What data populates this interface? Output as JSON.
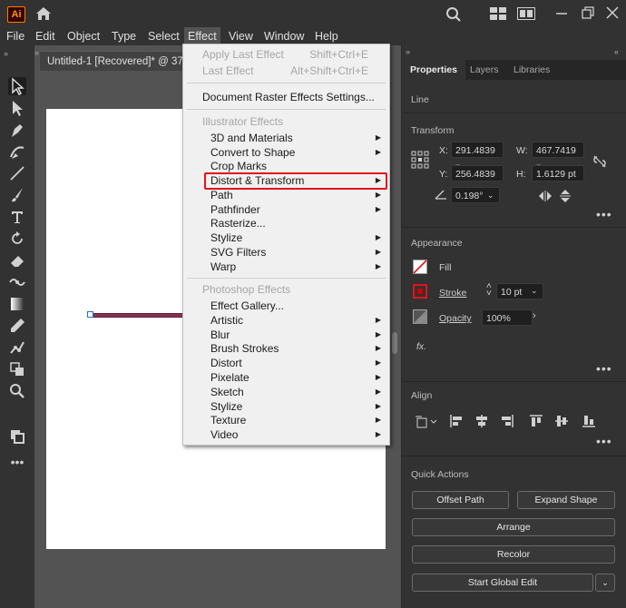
{
  "app": {
    "logo_text": "Ai"
  },
  "menubar": [
    "File",
    "Edit",
    "Object",
    "Type",
    "Select",
    "Effect",
    "View",
    "Window",
    "Help"
  ],
  "document": {
    "tab_title": "Untitled-1 [Recovered]* @ 37."
  },
  "effect_menu": {
    "apply_last": {
      "label": "Apply Last Effect",
      "shortcut": "Shift+Ctrl+E"
    },
    "last_effect": {
      "label": "Last Effect",
      "shortcut": "Alt+Shift+Ctrl+E"
    },
    "raster_settings": "Document Raster Effects Settings...",
    "illustrator_header": "Illustrator Effects",
    "illustrator_items": [
      "3D and Materials",
      "Convert to Shape",
      "Crop Marks",
      "Distort & Transform",
      "Path",
      "Pathfinder",
      "Rasterize...",
      "Stylize",
      "SVG Filters",
      "Warp"
    ],
    "photoshop_header": "Photoshop Effects",
    "photoshop_items": [
      "Effect Gallery...",
      "Artistic",
      "Blur",
      "Brush Strokes",
      "Distort",
      "Pixelate",
      "Sketch",
      "Stylize",
      "Texture",
      "Video"
    ],
    "highlighted": "Distort & Transform"
  },
  "panel": {
    "tabs": [
      "Properties",
      "Layers",
      "Libraries"
    ],
    "object_type": "Line",
    "transform": {
      "title": "Transform",
      "x_label": "X:",
      "x": "291.4839 p",
      "y_label": "Y:",
      "y": "256.4839 p",
      "w_label": "W:",
      "w": "467.7419 p",
      "h_label": "H:",
      "h": "1.6129 pt",
      "angle": "0.198°"
    },
    "appearance": {
      "title": "Appearance",
      "fill_label": "Fill",
      "stroke_label": "Stroke",
      "stroke_weight": "10 pt",
      "opacity_label": "Opacity",
      "opacity": "100%",
      "fx_label": "fx."
    },
    "align": {
      "title": "Align"
    },
    "quick_actions": {
      "title": "Quick Actions",
      "offset_path": "Offset Path",
      "expand_shape": "Expand Shape",
      "arrange": "Arrange",
      "recolor": "Recolor",
      "start_global_edit": "Start Global Edit"
    }
  },
  "colors": {
    "highlight_box": "#e0141c",
    "stroke_color": "#8a2f54",
    "accent": "#ff9a00"
  }
}
